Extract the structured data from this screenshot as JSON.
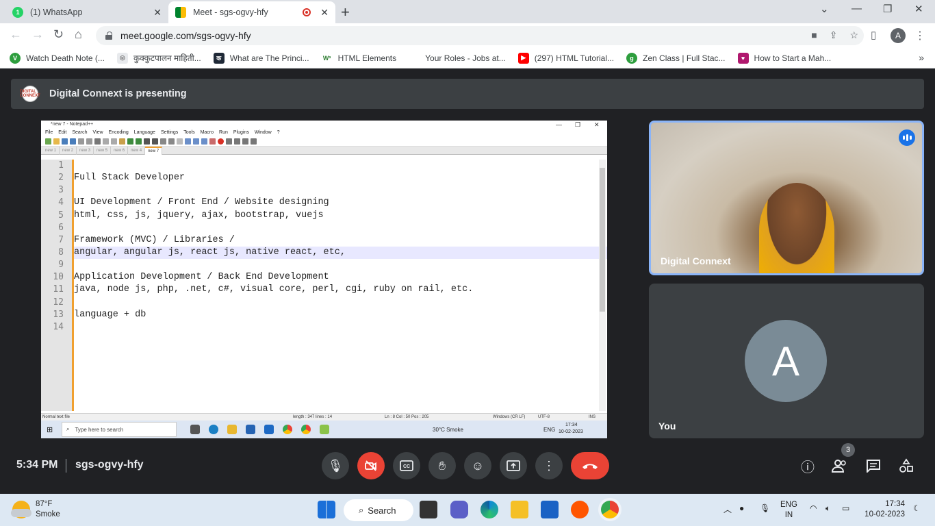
{
  "browser": {
    "tabs": [
      {
        "title": "(1) WhatsApp",
        "badge": "1"
      },
      {
        "title": "Meet - sgs-ogvy-hfy"
      }
    ],
    "url": "meet.google.com/sgs-ogvy-hfy",
    "profile_initial": "A",
    "bookmarks": [
      "Watch Death Note (...",
      "कुक्कुटपालन माहिती...",
      "What are The Princi...",
      "HTML Elements",
      "Your Roles - Jobs at...",
      "(297) HTML Tutorial...",
      "Zen Class | Full Stac...",
      "How to Start a Mah..."
    ]
  },
  "meet": {
    "presenting_text": "Digital Connext is presenting",
    "presenter_avatar_text": "DIGITAL CONNEXT",
    "main_tile_name": "Digital Connext",
    "self_tile_name": "You",
    "self_avatar": "A",
    "time": "5:34 PM",
    "meeting_code": "sgs-ogvy-hfy",
    "people_count": "3"
  },
  "shared_screen": {
    "window_title": "*new 7 - Notepad++",
    "menu": [
      "File",
      "Edit",
      "Search",
      "View",
      "Encoding",
      "Language",
      "Settings",
      "Tools",
      "Macro",
      "Run",
      "Plugins",
      "Window",
      "?"
    ],
    "tabs": [
      "new 1",
      "new 2",
      "new 3",
      "new 5",
      "new 6",
      "new 4",
      "new 7"
    ],
    "line_numbers": [
      "1",
      "2",
      "3",
      "4",
      "5",
      "6",
      "7",
      "8",
      "9",
      "10",
      "11",
      "12",
      "13",
      "14"
    ],
    "lines": [
      "",
      "Full Stack Developer",
      "",
      "UI Development / Front End / Website designing",
      "html, css, js, jquery, ajax, bootstrap, vuejs",
      "",
      "Framework (MVC) / Libraries /",
      "angular, angular js, react js, native react, etc,",
      "",
      "Application Development / Back End Development",
      "java, node js, php, .net, c#, visual core, perl, cgi, ruby on rail, etc.",
      "",
      "language + db",
      ""
    ],
    "status": {
      "type": "Normal text file",
      "length": "length : 347   lines : 14",
      "position": "Ln : 8   Col : 50   Pos : 205",
      "eol": "Windows (CR LF)",
      "encoding": "UTF-8",
      "mode": "INS"
    },
    "remote_taskbar": {
      "search": "Type here to search",
      "weather": "30°C  Smoke",
      "lang": "ENG",
      "time": "17:34",
      "date": "10-02-2023"
    }
  },
  "taskbar": {
    "temp": "87°F",
    "condition": "Smoke",
    "search_label": "Search",
    "lang_top": "ENG",
    "lang_bottom": "IN",
    "time": "17:34",
    "date": "10-02-2023"
  },
  "colors": {
    "meet_bg": "#202124",
    "end_call": "#ea4335",
    "speaker_border": "#8ab4f8",
    "notepad_accent": "#f0a030"
  }
}
